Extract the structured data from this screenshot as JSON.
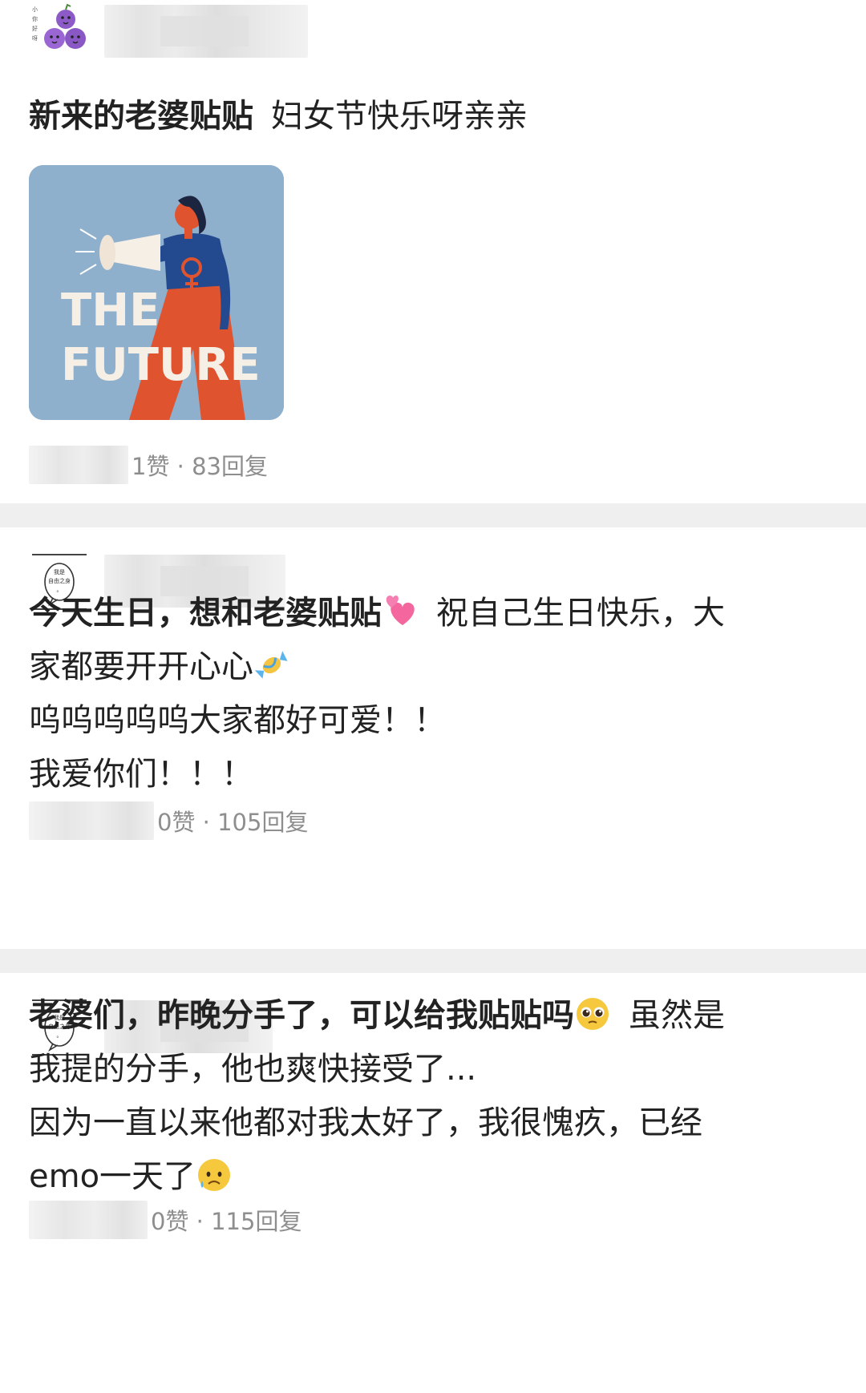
{
  "posts": [
    {
      "title": "新来的老婆贴贴",
      "body_lines": [
        "妇女节快乐呀亲亲"
      ],
      "image_text": [
        "THE",
        "FUTURE"
      ],
      "stats": "1赞 · 83回复"
    },
    {
      "title": "今天生日，想和老婆贴贴",
      "body_lines": [
        "祝自己生日快乐，大",
        "家都要开开心心",
        "呜呜呜呜呜大家都好可爱！！",
        "我爱你们！！！"
      ],
      "stats": "0赞 · 105回复",
      "avatar_text": [
        "我是",
        "自由之身",
        "。"
      ]
    },
    {
      "title": "老婆们，昨晚分手了，可以给我贴贴吗",
      "body_lines": [
        "虽然是",
        "我提的分手，他也爽快接受了...",
        "因为一直以来他都对我太好了，我很愧疚，已经",
        "emo一天了"
      ],
      "stats": "0赞 · 115回复",
      "avatar_text": [
        "我是",
        "自由之身",
        "。"
      ]
    }
  ],
  "colors": {
    "divider": "#efefef",
    "stats_text": "#8e8e8e",
    "image_bg": "#8fb0cc",
    "accent_orange": "#e0532f",
    "accent_blue": "#234a8e"
  },
  "icons": [
    "grape-cartoon-avatar",
    "speech-bubble-avatar",
    "two-hearts-icon",
    "candy-icon",
    "pleading-face-icon",
    "sad-sweat-face-icon"
  ]
}
